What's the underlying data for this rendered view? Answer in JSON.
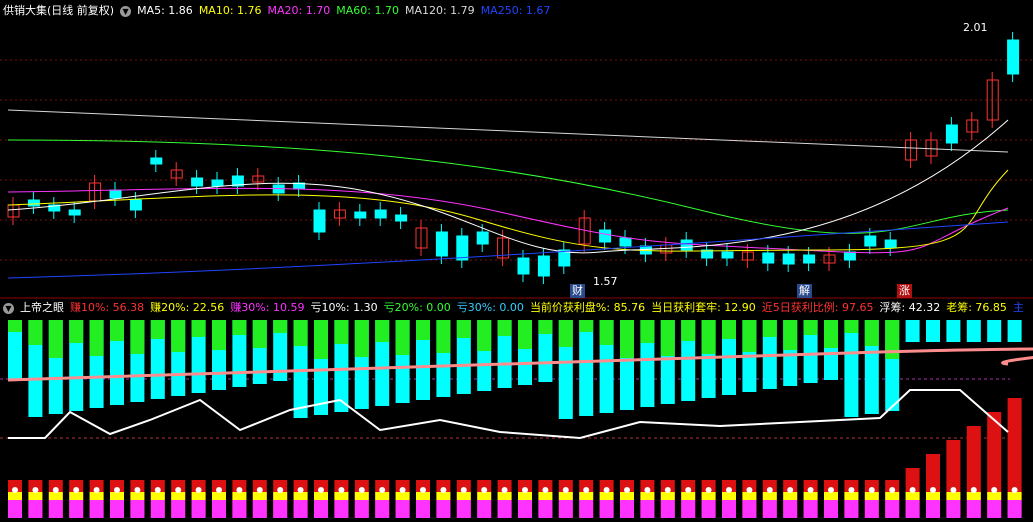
{
  "main_panel": {
    "title": "供销大集(日线 前复权)",
    "toggle_icon": "chevron-down-icon",
    "indicators": [
      {
        "label": "MA5: 1.86",
        "color": "#ffffff"
      },
      {
        "label": "MA10: 1.76",
        "color": "#ffff00"
      },
      {
        "label": "MA20: 1.70",
        "color": "#ff33ff"
      },
      {
        "label": "MA60: 1.70",
        "color": "#33ff33"
      },
      {
        "label": "MA120: 1.79",
        "color": "#d8d8d8"
      },
      {
        "label": "MA250: 1.67",
        "color": "#2244ff"
      }
    ],
    "price_high_label": "2.01",
    "price_low_label": "1.57",
    "event_badges": [
      {
        "label": "财",
        "bg": "#2a4a8c"
      },
      {
        "label": "解",
        "bg": "#2a4a8c"
      },
      {
        "label": "涨",
        "bg": "#b01010"
      }
    ],
    "colors": {
      "up": "#ff3232",
      "down": "#00ffff",
      "grid": "#7a1010"
    }
  },
  "sub_panel": {
    "title": "上帝之眼",
    "indicators": [
      {
        "label": "赚10%: 56.38",
        "color": "#ff3232"
      },
      {
        "label": "赚20%: 22.56",
        "color": "#ffff00"
      },
      {
        "label": "赚30%: 10.59",
        "color": "#ff33ff"
      },
      {
        "label": "亏10%: 1.30",
        "color": "#ffffff"
      },
      {
        "label": "亏20%: 0.00",
        "color": "#33ff33"
      },
      {
        "label": "亏30%: 0.00",
        "color": "#33ccff"
      },
      {
        "label": "当前价获利盘%: 85.76",
        "color": "#ffff00"
      },
      {
        "label": "当日获利套牢: 12.90",
        "color": "#ffff00"
      },
      {
        "label": "近5日获利比例: 97.65",
        "color": "#ff3232"
      },
      {
        "label": "浮筹: 42.32",
        "color": "#ffffff"
      },
      {
        "label": "老筹: 76.85",
        "color": "#ffff00"
      },
      {
        "label": "主",
        "color": "#2244ff"
      }
    ],
    "colors": {
      "cyan_bar": "#00ffff",
      "green_bar": "#22ee22",
      "pink_line": "#ff8c8c",
      "white_line": "#ffffff"
    }
  }
}
